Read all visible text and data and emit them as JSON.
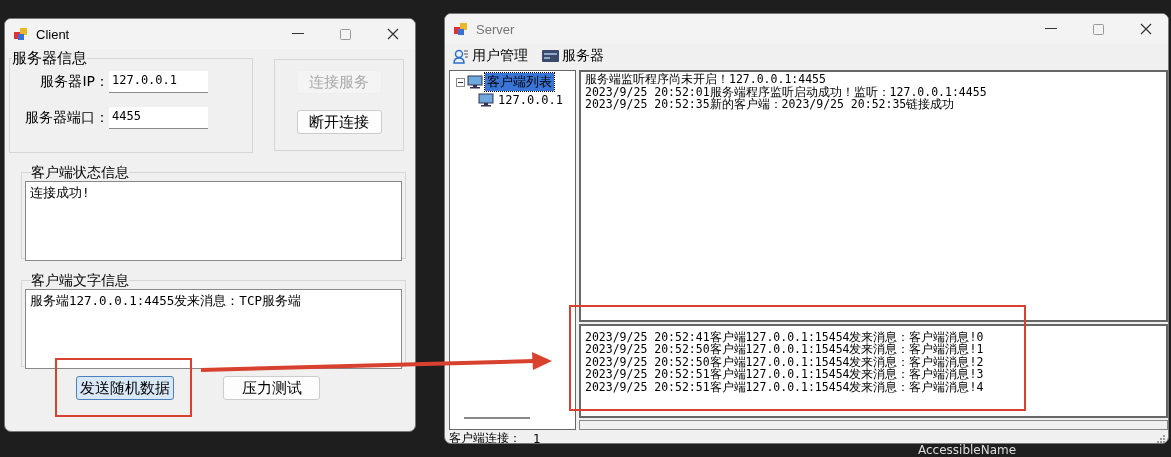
{
  "client_window": {
    "title": "Client",
    "server_group": {
      "title": "服务器信息",
      "fields": [
        {
          "label": "服务器IP：",
          "value": "127.0.0.1"
        },
        {
          "label": "服务器端口：",
          "value": "4455"
        }
      ]
    },
    "connection_buttons": [
      {
        "label": "连接服务",
        "disabled": true
      },
      {
        "label": "断开连接",
        "disabled": false
      }
    ],
    "status_group": {
      "title": "客户端状态信息",
      "text": "连接成功!"
    },
    "message_group": {
      "title": "客户端文字信息",
      "text": "服务端127.0.0.1:4455发来消息：TCP服务端"
    },
    "action_buttons": [
      {
        "label": "发送随机数据",
        "focused": true
      },
      {
        "label": "压力测试",
        "focused": false
      }
    ]
  },
  "server_window": {
    "title": "Server",
    "menu": [
      {
        "kind": "user",
        "label": "用户管理"
      },
      {
        "kind": "server",
        "label": "服务器"
      }
    ],
    "tree": {
      "label": "客户端列表",
      "selected": true,
      "expanded": true,
      "children": [
        {
          "label": "127.0.0.1",
          "selected": false
        }
      ]
    },
    "log_top": [
      "服务端监听程序尚未开启！127.0.0.1:4455",
      "2023/9/25 20:52:01服务端程序监听启动成功！监听：127.0.0.1:4455",
      "2023/9/25 20:52:35新的客户端：2023/9/25 20:52:35链接成功"
    ],
    "log_bottom": [
      "2023/9/25 20:52:41客户端127.0.0.1:15454发来消息：客户端消息!0",
      "2023/9/25 20:52:50客户端127.0.0.1:15454发来消息：客户端消息!1",
      "2023/9/25 20:52:50客户端127.0.0.1:15454发来消息：客户端消息!2",
      "2023/9/25 20:52:51客户端127.0.0.1:15454发来消息：客户端消息!3",
      "2023/9/25 20:52:51客户端127.0.0.1:15454发来消息：客户端消息!4"
    ],
    "status_label": "客户端连接：",
    "status_value": "1"
  },
  "desktop_text": "AccessibleName"
}
